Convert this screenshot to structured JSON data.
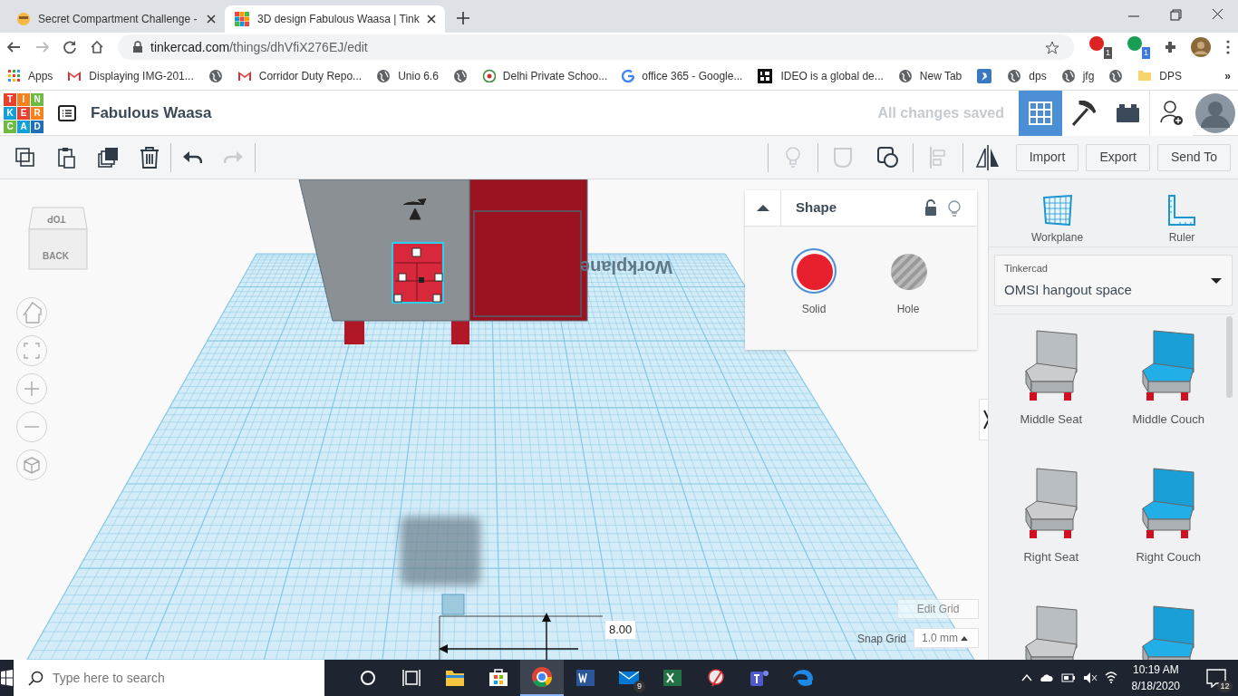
{
  "browser": {
    "tabs": [
      {
        "title": "Secret Compartment Challenge -",
        "kind": "emoji",
        "selected": false
      },
      {
        "title": "3D design Fabulous Waasa | Tink",
        "kind": "tinkercad",
        "selected": true
      }
    ],
    "address": {
      "host": "tinkercad.com",
      "path": "/things/dhVfiX276EJ/edit"
    },
    "extension_badges": [
      "1",
      "1"
    ],
    "bookmarks": [
      {
        "label": "Apps",
        "kind": "apps"
      },
      {
        "label": "Displaying IMG-201...",
        "kind": "mail"
      },
      {
        "kind": "site"
      },
      {
        "label": "Corridor Duty Repo...",
        "kind": "mail"
      },
      {
        "label": "Unio 6.6",
        "kind": "site"
      },
      {
        "kind": "site"
      },
      {
        "label": "Delhi Private Schoo...",
        "kind": "emblem"
      },
      {
        "label": "office 365 - Google...",
        "kind": "search"
      },
      {
        "label": "IDEO is a global de...",
        "kind": "square"
      },
      {
        "label": "New Tab",
        "kind": "site"
      },
      {
        "kind": "bird"
      },
      {
        "label": "dps",
        "kind": "site"
      },
      {
        "label": "jfg",
        "kind": "site"
      },
      {
        "kind": "site"
      },
      {
        "label": "DPS",
        "kind": "folder"
      }
    ],
    "bookmarks_overflow": "»"
  },
  "app": {
    "logo": [
      "T",
      "I",
      "N",
      "K",
      "E",
      "R",
      "C",
      "A",
      "D"
    ],
    "design_name": "Fabulous Waasa",
    "save_status": "All changes saved",
    "views": [
      {
        "kind": "grid",
        "selected": true
      },
      {
        "kind": "pickaxe",
        "selected": false
      },
      {
        "kind": "bricks",
        "selected": false
      }
    ],
    "toolbar_left": [
      {
        "kind": "copy",
        "disabled": false
      },
      {
        "kind": "paste",
        "disabled": false
      },
      {
        "kind": "duplicate",
        "disabled": false
      },
      {
        "kind": "delete",
        "disabled": false
      },
      {
        "kind": "undo",
        "disabled": false
      },
      {
        "kind": "redo",
        "disabled": true
      }
    ],
    "toolbar_right": [
      {
        "kind": "bulb",
        "disabled": true
      },
      {
        "kind": "note",
        "disabled": true
      },
      {
        "kind": "group",
        "disabled": false
      },
      {
        "kind": "align",
        "disabled": true
      },
      {
        "kind": "mirror",
        "disabled": false
      }
    ],
    "actions": [
      "Import",
      "Export",
      "Send To"
    ]
  },
  "view_cube": {
    "top": "TOP",
    "front": "BACK"
  },
  "canvas": {
    "workplane_label": "Workplane",
    "dimension": "8.00",
    "edit_grid": "Edit Grid",
    "snap_grid_label": "Snap Grid",
    "snap_grid_value": "1.0 mm"
  },
  "shape_panel": {
    "title": "Shape",
    "options": [
      {
        "label": "Solid",
        "kind": "solid",
        "selected": true
      },
      {
        "label": "Hole",
        "kind": "hole",
        "selected": false
      }
    ]
  },
  "right_panel": {
    "tools": [
      {
        "label": "Workplane",
        "kind": "workplane"
      },
      {
        "label": "Ruler",
        "kind": "ruler"
      }
    ],
    "library": {
      "source": "Tinkercad",
      "name": "OMSI hangout space"
    },
    "shapes": [
      {
        "label": "Middle Seat",
        "kind": "seat"
      },
      {
        "label": "Middle Couch",
        "kind": "couch"
      },
      {
        "label": "Right Seat",
        "kind": "seat"
      },
      {
        "label": "Right Couch",
        "kind": "couch"
      },
      {
        "kind": "seat"
      },
      {
        "kind": "couch"
      }
    ]
  },
  "taskbar": {
    "search_placeholder": "Type here to search",
    "apps": [
      {
        "kind": "cortana",
        "selected": false
      },
      {
        "kind": "taskview",
        "selected": false
      },
      {
        "kind": "explorer",
        "selected": false
      },
      {
        "kind": "store",
        "selected": false
      },
      {
        "kind": "chrome",
        "selected": true
      },
      {
        "kind": "word",
        "selected": false
      },
      {
        "kind": "mail",
        "selected": false,
        "badge": "9"
      },
      {
        "kind": "excel",
        "selected": false
      },
      {
        "kind": "snip",
        "selected": false
      },
      {
        "kind": "teams",
        "selected": false
      },
      {
        "kind": "edge",
        "selected": false
      }
    ],
    "time": "10:19 AM",
    "date": "8/18/2020",
    "notifications": "12"
  }
}
